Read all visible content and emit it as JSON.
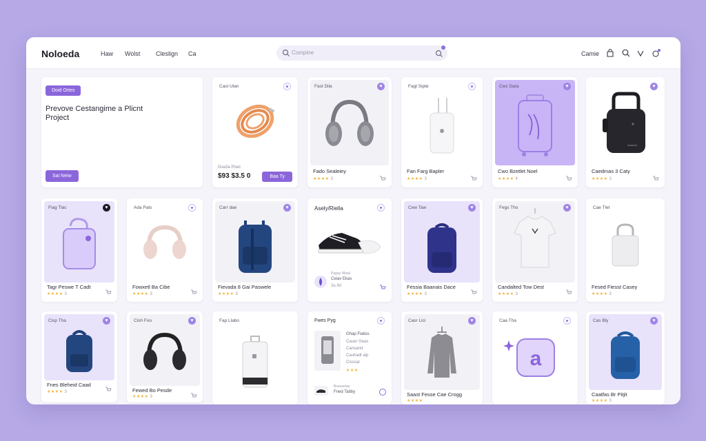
{
  "app": {
    "brand": "Noloeda",
    "nav": [
      "Haw",
      "Wolst",
      "Cleslign",
      "Ca"
    ],
    "search_placeholder": "Compine",
    "right_label": "Camie"
  },
  "promo": {
    "badge": "Doid Ortes",
    "headline": "Prevove Cestangime a Plicnt Project",
    "button": "Sai Neiw"
  },
  "products": [
    {
      "tag": "Cast Ulan",
      "name": "",
      "price_label": "Doa3a Ploel",
      "price": "$93 $3.5 0",
      "buy": "Baa Ty"
    },
    {
      "tag": "Fast Dila",
      "name": "Fado Sealeiey",
      "rating": "3"
    },
    {
      "tag": "Fagt Sipte",
      "name": "Fan Farg Bapler",
      "rating": "3"
    },
    {
      "tag": "Cwc Dara",
      "name": "Cwo Bzetlet Noel",
      "rating": "4"
    },
    {
      "tag": "",
      "name": "Caedmas 3 Caty",
      "rating": "3"
    },
    {
      "tag": "Fiag Tlac",
      "name": "Tagr Peswe T Cadt",
      "rating": "3"
    },
    {
      "tag": "Ada Pats",
      "name": "Fowxetl Ba Cibe",
      "rating": "3"
    },
    {
      "tag": "Carr dae",
      "name": "Fievada 8 Gai Paswele",
      "rating": "3"
    },
    {
      "tag": "Asely/Riella",
      "name": "Ceiav Ekas",
      "sub": "Pagay Wiaal",
      "price": "3a 8d"
    },
    {
      "tag": "Cew Taw",
      "name": "Fessia Baanais Dace",
      "rating": "3"
    },
    {
      "tag": "Fegs Tho",
      "name": "Candalted Tow Dest",
      "rating": "3"
    },
    {
      "tag": "Cae Tlet",
      "name": "Fesed Fiesst Casey",
      "rating": "3"
    },
    {
      "tag": "Cisp Tha",
      "name": "Fnes Bleheid Caad",
      "rating": "3"
    },
    {
      "tag": "Cish Foo",
      "name": "Fewed Bo Pesde",
      "rating": "3"
    },
    {
      "tag": "Fap Llabo",
      "name": "",
      "rating": ""
    },
    {
      "tag": "Fwes Pyg",
      "name": "Fned Tabby",
      "sub": "Boeaxetas",
      "list": [
        "Ghap Fiatiss",
        "Cauer Geas",
        "Cansaret",
        "Cauhadt aip",
        "Cisssar"
      ]
    },
    {
      "tag": "Casr Lici",
      "name": "Saast Fesse Cae Crogg",
      "rating": "3"
    },
    {
      "tag": "Caa Tha",
      "name": "",
      "rating": ""
    },
    {
      "tag": "Cas Bly",
      "name": "Caatfas Br Pitjit",
      "rating": "3"
    }
  ],
  "colors": {
    "accent": "#8b66db",
    "background": "#b6a9e6",
    "star": "#f0b33a"
  }
}
